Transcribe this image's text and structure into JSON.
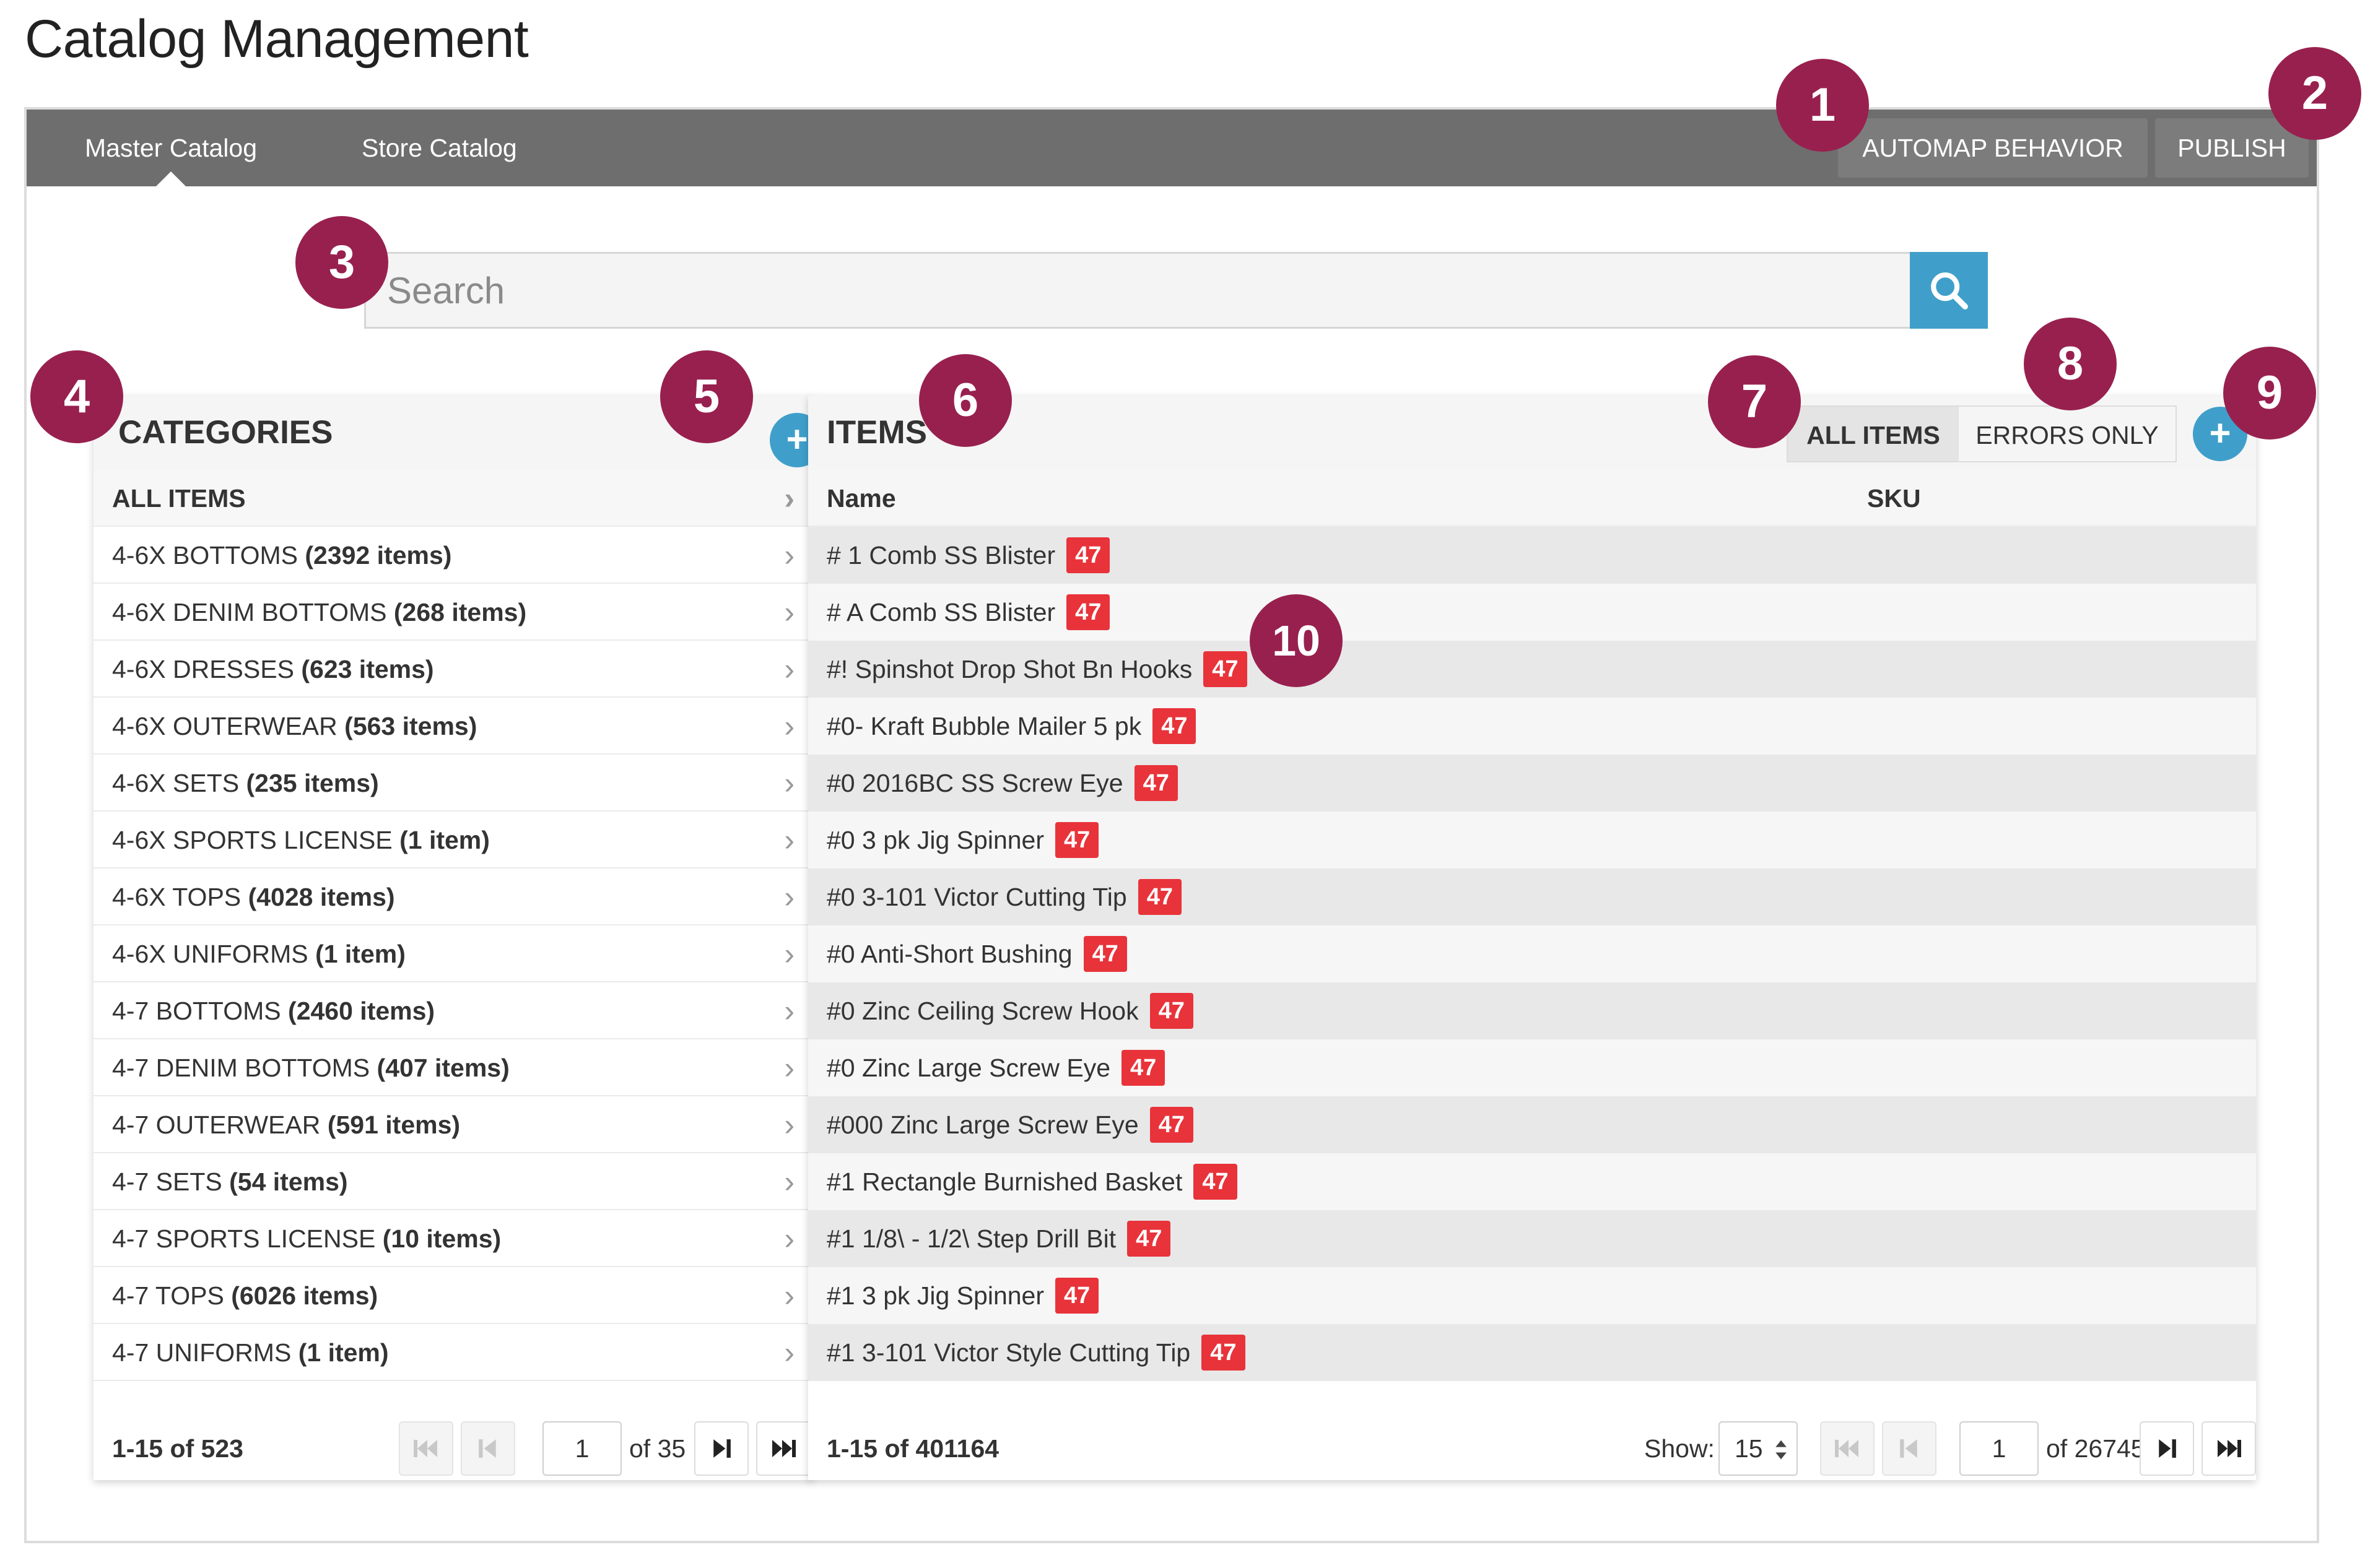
{
  "page_title": "Catalog Management",
  "nav": {
    "tabs": [
      {
        "label": "Master Catalog",
        "active": true
      },
      {
        "label": "Store Catalog",
        "active": false
      }
    ],
    "automap_label": "AUTOMAP BEHAVIOR",
    "publish_label": "PUBLISH"
  },
  "search": {
    "placeholder": "Search",
    "value": "",
    "icon": "search-icon"
  },
  "categories": {
    "title": "CATEGORIES",
    "add_icon": "plus-icon",
    "all_items_label": "ALL ITEMS",
    "rows": [
      {
        "name": "4-6X BOTTOMS",
        "count": "(2392 items)"
      },
      {
        "name": "4-6X DENIM BOTTOMS",
        "count": "(268 items)"
      },
      {
        "name": "4-6X DRESSES",
        "count": "(623 items)"
      },
      {
        "name": "4-6X OUTERWEAR",
        "count": "(563 items)"
      },
      {
        "name": "4-6X SETS",
        "count": "(235 items)"
      },
      {
        "name": "4-6X SPORTS LICENSE",
        "count": "(1 item)"
      },
      {
        "name": "4-6X TOPS",
        "count": "(4028 items)"
      },
      {
        "name": "4-6X UNIFORMS",
        "count": "(1 item)"
      },
      {
        "name": "4-7 BOTTOMS",
        "count": "(2460 items)"
      },
      {
        "name": "4-7 DENIM BOTTOMS",
        "count": "(407 items)"
      },
      {
        "name": "4-7 OUTERWEAR",
        "count": "(591 items)"
      },
      {
        "name": "4-7 SETS",
        "count": "(54 items)"
      },
      {
        "name": "4-7 SPORTS LICENSE",
        "count": "(10 items)"
      },
      {
        "name": "4-7 TOPS",
        "count": "(6026 items)"
      },
      {
        "name": "4-7 UNIFORMS",
        "count": "(1 item)"
      }
    ],
    "footer": {
      "range": "1-15 of 523",
      "page": "1",
      "of": "of 35"
    }
  },
  "items": {
    "title": "ITEMS",
    "filter_all": "ALL ITEMS",
    "filter_errors": "ERRORS ONLY",
    "add_icon": "plus-icon",
    "columns": {
      "name": "Name",
      "sku": "SKU"
    },
    "rows": [
      {
        "name": "# 1 Comb SS Blister",
        "badge": "47",
        "sku": ""
      },
      {
        "name": "# A Comb SS Blister",
        "badge": "47",
        "sku": ""
      },
      {
        "name": "#! Spinshot Drop Shot Bn Hooks",
        "badge": "47",
        "sku": ""
      },
      {
        "name": "#0- Kraft Bubble Mailer 5 pk",
        "badge": "47",
        "sku": ""
      },
      {
        "name": "#0 2016BC SS Screw Eye",
        "badge": "47",
        "sku": ""
      },
      {
        "name": "#0 3 pk Jig Spinner",
        "badge": "47",
        "sku": ""
      },
      {
        "name": "#0 3-101 Victor Cutting Tip",
        "badge": "47",
        "sku": ""
      },
      {
        "name": "#0 Anti-Short Bushing",
        "badge": "47",
        "sku": ""
      },
      {
        "name": "#0 Zinc Ceiling Screw Hook",
        "badge": "47",
        "sku": ""
      },
      {
        "name": "#0 Zinc Large Screw Eye",
        "badge": "47",
        "sku": ""
      },
      {
        "name": "#000 Zinc Large Screw Eye",
        "badge": "47",
        "sku": ""
      },
      {
        "name": "#1 Rectangle Burnished Basket",
        "badge": "47",
        "sku": ""
      },
      {
        "name": "#1 1/8\\ - 1/2\\ Step Drill Bit",
        "badge": "47",
        "sku": ""
      },
      {
        "name": "#1 3 pk Jig Spinner",
        "badge": "47",
        "sku": ""
      },
      {
        "name": "#1 3-101 Victor Style Cutting Tip",
        "badge": "47",
        "sku": ""
      }
    ],
    "footer": {
      "range": "1-15 of 401164",
      "show_label": "Show:",
      "show_value": "15",
      "page": "1",
      "of": "of 26745"
    }
  },
  "markers": [
    "1",
    "2",
    "3",
    "4",
    "5",
    "6",
    "7",
    "8",
    "9",
    "10"
  ],
  "colors": {
    "navbar": "#6e6e6e",
    "accent": "#3f9fca",
    "badge": "#e8333a",
    "marker": "#98204f"
  }
}
